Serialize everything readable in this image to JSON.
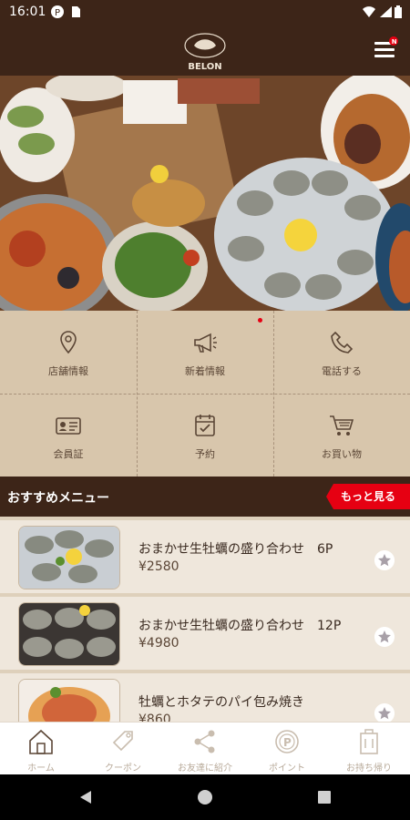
{
  "status_bar": {
    "time": "16:01"
  },
  "app": {
    "logo_text": "BELON"
  },
  "menu_badge": "N",
  "quick_menu": [
    {
      "label": "店舗情報",
      "icon": "location-pin-icon"
    },
    {
      "label": "新着情報",
      "icon": "megaphone-icon"
    },
    {
      "label": "電話する",
      "icon": "phone-icon"
    },
    {
      "label": "会員証",
      "icon": "member-card-icon"
    },
    {
      "label": "予約",
      "icon": "reservation-icon"
    },
    {
      "label": "お買い物",
      "icon": "shopping-cart-icon"
    }
  ],
  "recommend": {
    "title": "おすすめメニュー",
    "more_label": "もっと見る",
    "items": [
      {
        "name": "おまかせ生牡蠣の盛り合わせ　6P",
        "price": "¥2580"
      },
      {
        "name": "おまかせ生牡蠣の盛り合わせ　12P",
        "price": "¥4980"
      },
      {
        "name": "牡蠣とホタテのパイ包み焼き",
        "price": "¥860"
      }
    ]
  },
  "bottom_nav": [
    {
      "label": "ホーム",
      "icon": "home-icon",
      "active": true
    },
    {
      "label": "クーポン",
      "icon": "coupon-tag-icon"
    },
    {
      "label": "お友達に紹介",
      "icon": "share-icon"
    },
    {
      "label": "ポイント",
      "icon": "point-icon"
    },
    {
      "label": "お持ち帰り",
      "icon": "takeout-icon"
    }
  ],
  "colors": {
    "brand_brown": "#3d2518",
    "accent_red": "#e60012",
    "beige": "#d8c6ac"
  }
}
